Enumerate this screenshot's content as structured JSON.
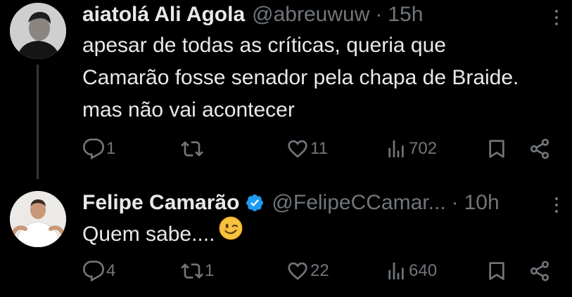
{
  "tweets": [
    {
      "name": "aiatolá Ali Agola",
      "handle": "@abreuwuw",
      "separator": "·",
      "time": "15h",
      "verified": false,
      "text": "apesar de todas as críticas, queria que\nCamarão fosse senador pela chapa de Braide.\nmas não vai acontecer",
      "replies": "1",
      "retweets": "",
      "likes": "11",
      "views": "702"
    },
    {
      "name": "Felipe Camarão",
      "handle": "@FelipeCCamar...",
      "separator": "·",
      "time": "10h",
      "verified": true,
      "text": "Quem sabe....",
      "emoji": "winking-face",
      "replies": "4",
      "retweets": "1",
      "likes": "22",
      "views": "640"
    }
  ],
  "colors": {
    "background": "#000000",
    "text": "#e7e9ea",
    "secondary": "#71767b",
    "thread_line": "#333639",
    "verified": "#1d9bf0"
  },
  "icons": [
    "reply-icon",
    "retweet-icon",
    "like-icon",
    "views-icon",
    "bookmark-icon",
    "share-icon",
    "more-icon",
    "verified-badge-icon"
  ]
}
